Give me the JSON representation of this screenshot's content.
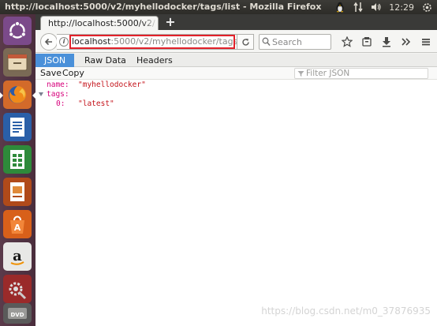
{
  "top_panel": {
    "window_title": "http://localhost:5000/v2/myhellodocker/tags/list - Mozilla Firefox",
    "clock": "12:29"
  },
  "launcher": {
    "items": [
      "ubuntu-dash",
      "files",
      "firefox",
      "writer",
      "calc",
      "impress",
      "software-center",
      "amazon",
      "system-settings",
      "dvd"
    ]
  },
  "browser": {
    "tab_title": "http://localhost:5000/v2/",
    "new_tab": "+",
    "url_host": "localhost",
    "url_path": ":5000/v2/myhellodocker/tags/l",
    "search_placeholder": "Search"
  },
  "json_viewer": {
    "tabs": [
      "JSON",
      "Raw Data",
      "Headers"
    ],
    "active_tab": "JSON",
    "toolbar": {
      "save": "Save",
      "copy": "Copy"
    },
    "filter_placeholder": "Filter JSON",
    "rows": {
      "name_key": "name:",
      "name_value": "\"myhellodocker\"",
      "tags_key": "tags:",
      "tag0_key": "0:",
      "tag0_value": "\"latest\""
    }
  },
  "watermark": "https://blog.csdn.net/m0_37876935",
  "colors": {
    "accent": "#4a90d9",
    "highlight": "#e2212a",
    "json_key": "#d7027c",
    "json_string": "#c4121a"
  }
}
